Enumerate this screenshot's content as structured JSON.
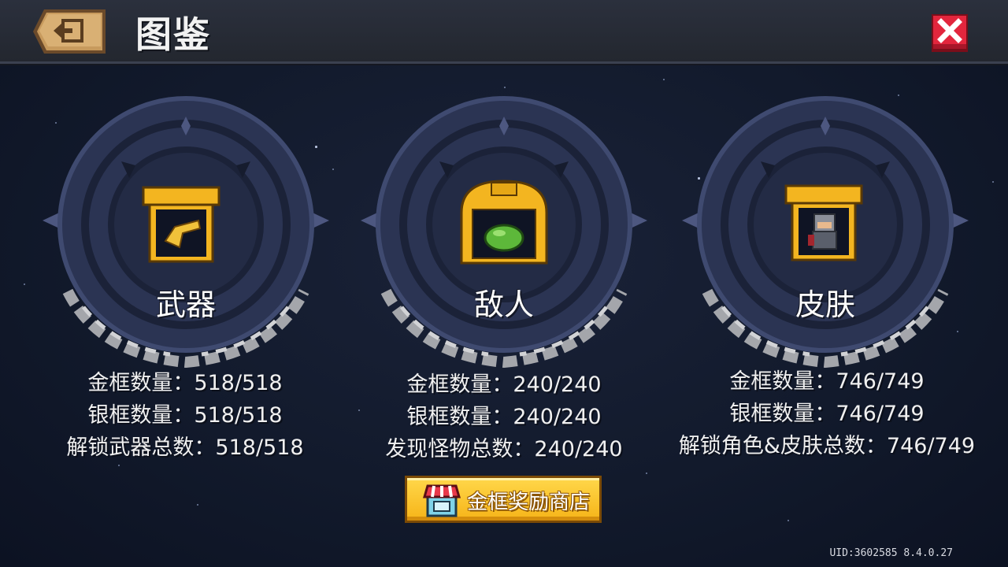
{
  "header": {
    "title": "图鉴"
  },
  "sections": [
    {
      "title": "武器",
      "stats": [
        "金框数量：518/518",
        "银框数量：518/518",
        "解锁武器总数：518/518"
      ]
    },
    {
      "title": "敌人",
      "stats": [
        "金框数量：240/240",
        "银框数量：240/240",
        "发现怪物总数：240/240"
      ]
    },
    {
      "title": "皮肤",
      "stats": [
        "金框数量：746/749",
        "银框数量：746/749",
        "解锁角色&皮肤总数：746/749"
      ]
    }
  ],
  "shop_button": {
    "label": "金框奖励商店"
  },
  "footer": {
    "uid": "UID:3602585 8.4.0.27"
  },
  "icons": {
    "back": "exit-arrow-icon",
    "close": "close-x-icon",
    "weapons": "golden-pistol-icon",
    "enemies": "green-slime-icon",
    "skins": "knight-character-icon",
    "shop": "shop-stall-icon"
  },
  "colors": {
    "background": "#121a2c",
    "topbar": "#2b303d",
    "close_red": "#d8243a",
    "gold_frame": "#f3b520",
    "medallion": "#2a3350"
  }
}
